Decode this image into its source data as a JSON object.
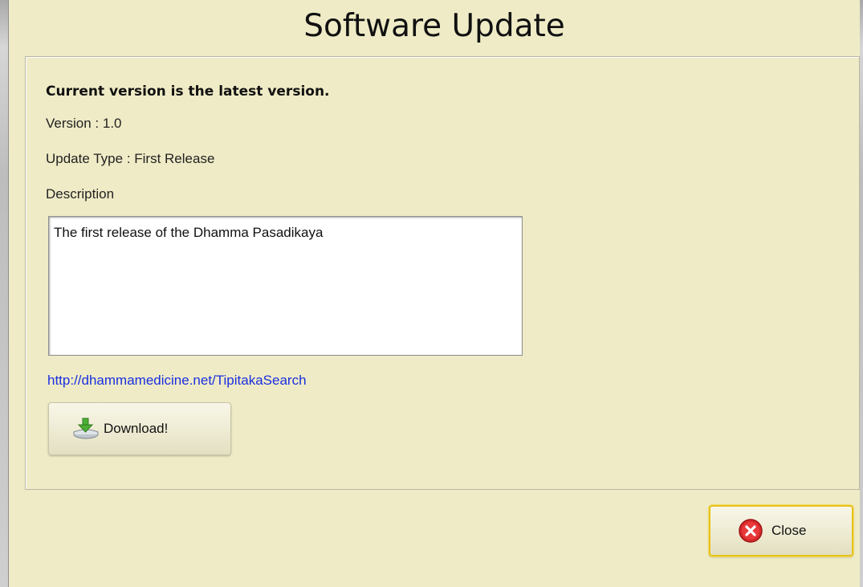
{
  "dialog": {
    "title": "Software Update",
    "status_message": "Current version is the latest version.",
    "version_text": "Version : 1.0",
    "update_type_text": "Update Type : First Release",
    "description_label": "Description",
    "description_text": "The first release of the Dhamma Pasadikaya",
    "link_text": "http://dhammamedicine.net/TipitakaSearch",
    "download_label": "Download!",
    "close_label": "Close"
  },
  "icons": {
    "download": "download-drive-icon",
    "close": "close-circle-icon"
  },
  "colors": {
    "dialog_background": "#efebc6",
    "link": "#1a2fe0",
    "close_focus_border": "#e6c21b",
    "close_icon_red": "#d6282b"
  }
}
